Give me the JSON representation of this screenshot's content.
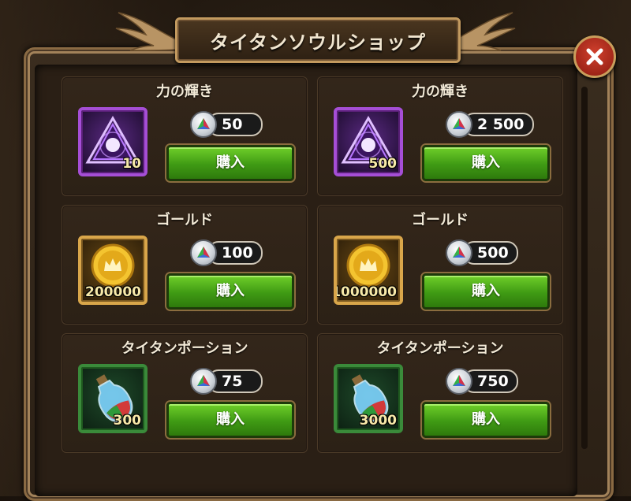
{
  "shop": {
    "title": "タイタンソウルショップ",
    "buy_label": "購入",
    "cards": [
      {
        "name": "力の輝き",
        "quantity": "10",
        "price": "50",
        "icon": "rune-shard-icon",
        "color": "purple"
      },
      {
        "name": "力の輝き",
        "quantity": "500",
        "price": "2 500",
        "icon": "rune-shard-icon",
        "color": "purple"
      },
      {
        "name": "ゴールド",
        "quantity": "200000",
        "price": "100",
        "icon": "gold-coin-icon",
        "color": "gold"
      },
      {
        "name": "ゴールド",
        "quantity": "1000000",
        "price": "500",
        "icon": "gold-coin-icon",
        "color": "gold"
      },
      {
        "name": "タイタンポーション",
        "quantity": "300",
        "price": "75",
        "icon": "potion-bottle-icon",
        "color": "green"
      },
      {
        "name": "タイタンポーション",
        "quantity": "3000",
        "price": "750",
        "icon": "potion-bottle-icon",
        "color": "green"
      }
    ]
  },
  "currency_icon": "titan-soul-gem-icon",
  "close_icon": "close-icon",
  "colors": {
    "buy_button": "#4bb01a",
    "frame_gold": "#c39a5f",
    "close_red": "#c0392b"
  }
}
